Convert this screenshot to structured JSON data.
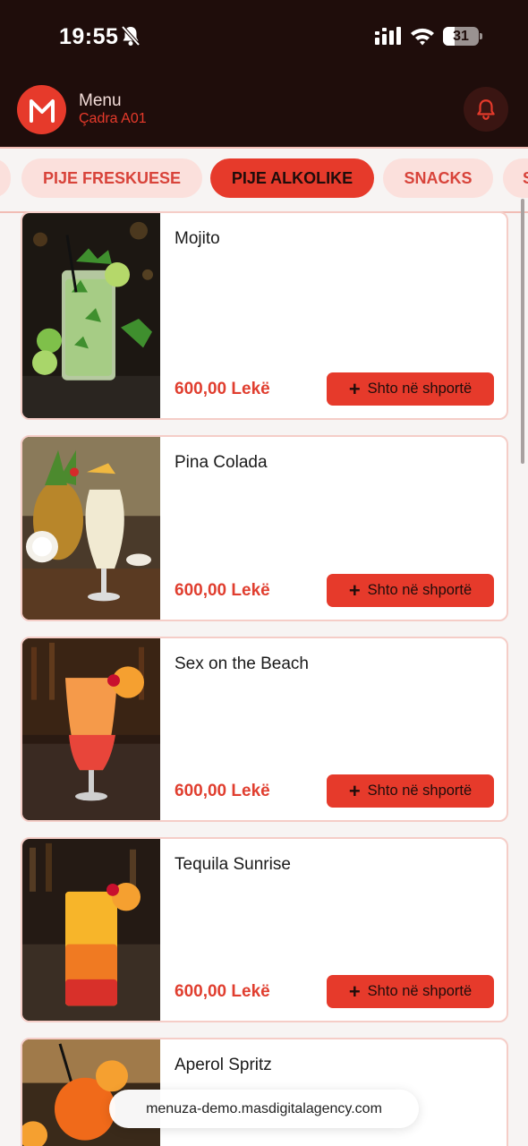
{
  "status_bar": {
    "time": "19:55",
    "battery": "31"
  },
  "header": {
    "title": "Menu",
    "subtitle": "Çadra A01",
    "logo_letter": "M"
  },
  "categories": [
    {
      "label": ""
    },
    {
      "label": "PIJE FRESKUESE"
    },
    {
      "label": "PIJE ALKOLIKE",
      "active": true
    },
    {
      "label": "SNACKS"
    },
    {
      "label": "S"
    }
  ],
  "products": [
    {
      "name": "Mojito",
      "price": "600,00 Lekë",
      "button": "Shto në shportë"
    },
    {
      "name": "Pina Colada",
      "price": "600,00 Lekë",
      "button": "Shto në shportë"
    },
    {
      "name": "Sex on the Beach",
      "price": "600,00 Lekë",
      "button": "Shto në shportë"
    },
    {
      "name": "Tequila Sunrise",
      "price": "600,00 Lekë",
      "button": "Shto në shportë"
    },
    {
      "name": "Aperol Spritz"
    }
  ],
  "browser": {
    "url": "menuza-demo.masdigitalagency.com"
  },
  "colors": {
    "accent": "#e63a2b",
    "header_bg": "#1f0d0b",
    "tab_bg": "#fbe0dc",
    "price": "#e03e2f"
  },
  "icons": [
    "bell-slash-icon",
    "signal-icon",
    "wifi-icon",
    "battery-icon",
    "logo-icon",
    "bell-icon",
    "plus-icon"
  ]
}
